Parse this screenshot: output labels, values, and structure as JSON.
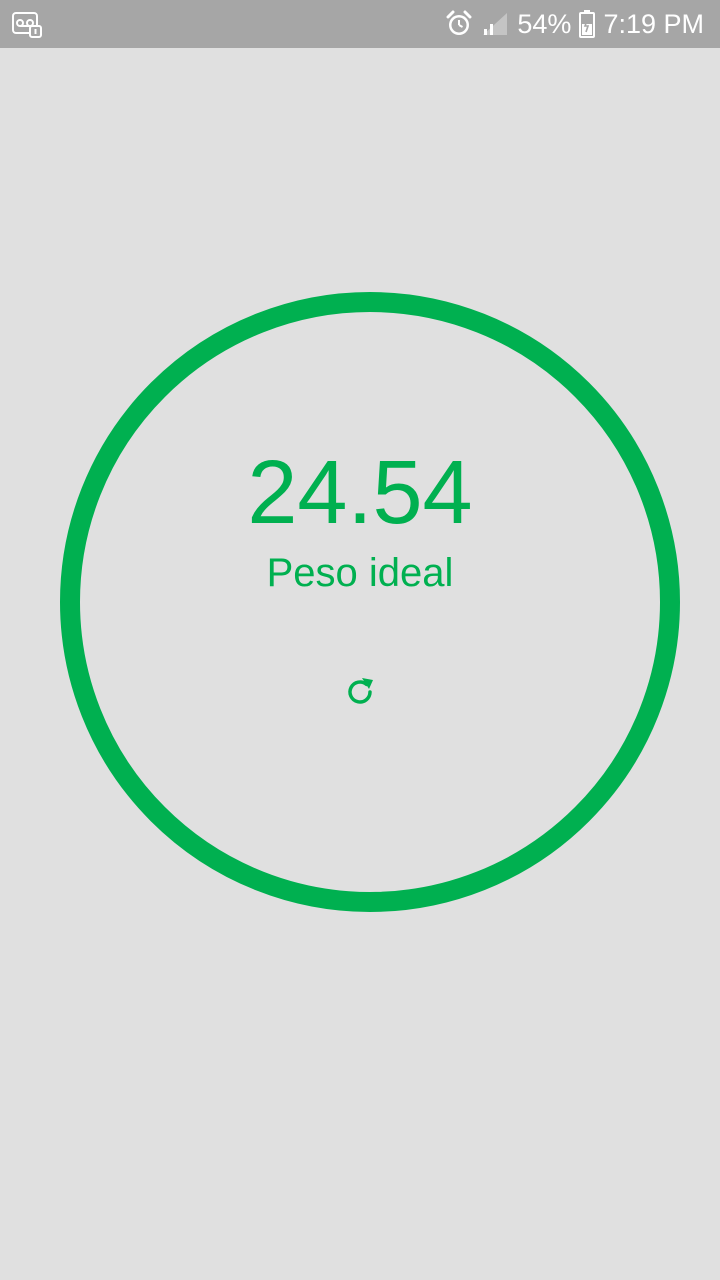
{
  "status_bar": {
    "left_icon": "voicemail-icon",
    "alarm_icon": "alarm-icon",
    "signal_icon": "signal-icon",
    "battery_percent": "54%",
    "battery_icon": "battery-icon",
    "time": "7:19 PM"
  },
  "result": {
    "value": "24.54",
    "label": "Peso ideal",
    "refresh_icon": "refresh-icon"
  },
  "colors": {
    "accent": "#00b050",
    "background": "#e0e0e0",
    "status_bar": "#a6a6a6"
  }
}
